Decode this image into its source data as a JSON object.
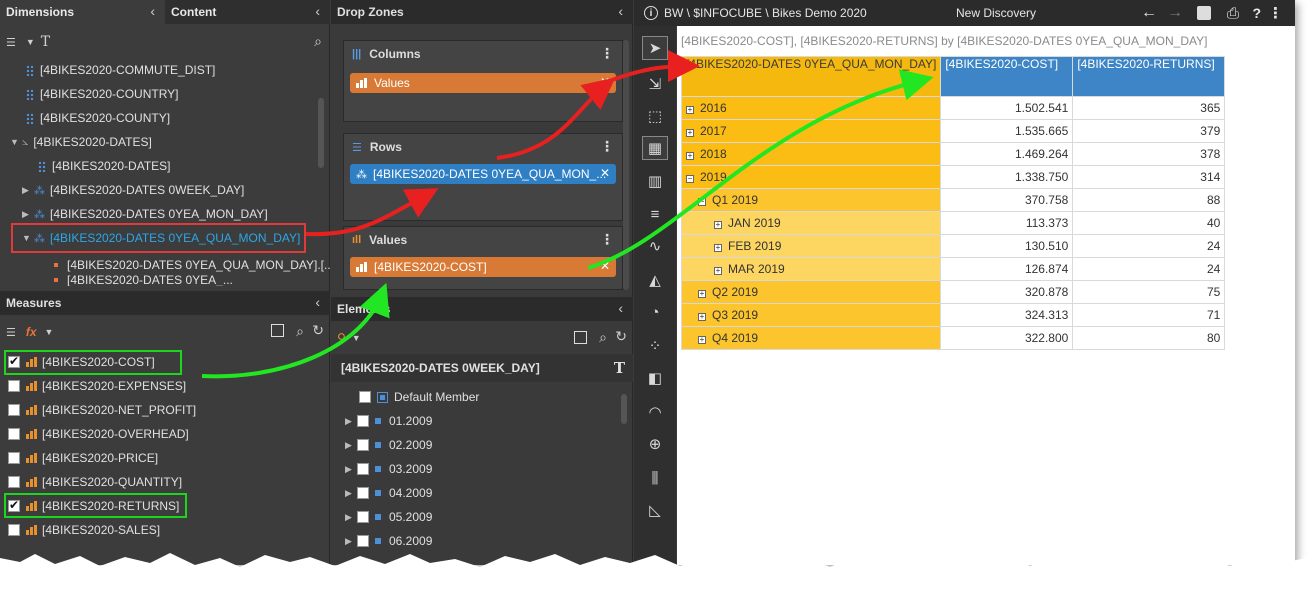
{
  "dimensions_panel": {
    "tab_dimensions": "Dimensions",
    "tab_content": "Content",
    "items": [
      {
        "label": "[4BIKES2020-COMMUTE_DIST]"
      },
      {
        "label": "[4BIKES2020-COUNTRY]"
      },
      {
        "label": "[4BIKES2020-COUNTY]"
      },
      {
        "label": "[4BIKES2020-DATES]"
      },
      {
        "label": "[4BIKES2020-DATES]"
      },
      {
        "label": "[4BIKES2020-DATES 0WEEK_DAY]"
      },
      {
        "label": "[4BIKES2020-DATES 0YEA_MON_DAY]"
      },
      {
        "label": "[4BIKES2020-DATES 0YEA_QUA_MON_DAY]"
      },
      {
        "label": "[4BIKES2020-DATES 0YEA_QUA_MON_DAY].[..."
      },
      {
        "label": "[4BIKES2020-DATES 0YEA_..."
      }
    ]
  },
  "measures_panel": {
    "title": "Measures",
    "items": [
      {
        "label": "[4BIKES2020-COST]",
        "checked": true
      },
      {
        "label": "[4BIKES2020-EXPENSES]",
        "checked": false
      },
      {
        "label": "[4BIKES2020-NET_PROFIT]",
        "checked": false
      },
      {
        "label": "[4BIKES2020-OVERHEAD]",
        "checked": false
      },
      {
        "label": "[4BIKES2020-PRICE]",
        "checked": false
      },
      {
        "label": "[4BIKES2020-QUANTITY]",
        "checked": false
      },
      {
        "label": "[4BIKES2020-RETURNS]",
        "checked": true
      },
      {
        "label": "[4BIKES2020-SALES]",
        "checked": false
      }
    ]
  },
  "drop_zones": {
    "title": "Drop Zones",
    "columns": {
      "label": "Columns",
      "pill": "Values"
    },
    "rows": {
      "label": "Rows",
      "pill": "[4BIKES2020-DATES 0YEA_QUA_MON_..."
    },
    "values": {
      "label": "Values",
      "pill": "[4BIKES2020-COST]"
    }
  },
  "elements_panel": {
    "title": "Elements",
    "hierarchy": "[4BIKES2020-DATES 0WEEK_DAY]",
    "items": [
      {
        "label": "Default Member"
      },
      {
        "label": "01.2009"
      },
      {
        "label": "02.2009"
      },
      {
        "label": "03.2009"
      },
      {
        "label": "04.2009"
      },
      {
        "label": "05.2009"
      },
      {
        "label": "06.2009"
      }
    ]
  },
  "topbar": {
    "path": "BW \\ $INFOCUBE \\ Bikes Demo 2020",
    "title": "New Discovery"
  },
  "report": {
    "title": "[4BIKES2020-COST], [4BIKES2020-RETURNS] by [4BIKES2020-DATES 0YEA_QUA_MON_DAY]",
    "row_header": "[4BIKES2020-DATES 0YEA_QUA_MON_DAY]",
    "col_headers": [
      "[4BIKES2020-COST]",
      "[4BIKES2020-RETURNS]"
    ],
    "rows": [
      {
        "label": "2016",
        "level": 0,
        "expander": "+",
        "cost": "1.502.541",
        "returns": "365"
      },
      {
        "label": "2017",
        "level": 0,
        "expander": "+",
        "cost": "1.535.665",
        "returns": "379"
      },
      {
        "label": "2018",
        "level": 0,
        "expander": "+",
        "cost": "1.469.264",
        "returns": "378"
      },
      {
        "label": "2019",
        "level": 0,
        "expander": "−",
        "cost": "1.338.750",
        "returns": "314"
      },
      {
        "label": "Q1 2019",
        "level": 1,
        "expander": "−",
        "cost": "370.758",
        "returns": "88"
      },
      {
        "label": "JAN 2019",
        "level": 2,
        "expander": "+",
        "cost": "113.373",
        "returns": "40"
      },
      {
        "label": "FEB 2019",
        "level": 2,
        "expander": "+",
        "cost": "130.510",
        "returns": "24"
      },
      {
        "label": "MAR 2019",
        "level": 2,
        "expander": "+",
        "cost": "126.874",
        "returns": "24"
      },
      {
        "label": "Q2 2019",
        "level": 1,
        "expander": "+",
        "cost": "320.878",
        "returns": "75"
      },
      {
        "label": "Q3 2019",
        "level": 1,
        "expander": "+",
        "cost": "324.313",
        "returns": "71"
      },
      {
        "label": "Q4 2019",
        "level": 1,
        "expander": "+",
        "cost": "322.800",
        "returns": "80"
      }
    ]
  },
  "colors": {
    "accent_blue": "#2ea6e8",
    "pill_orange": "#d87a36",
    "pill_blue": "#2f7fc4",
    "header_blue": "#3d85c6",
    "gold": "#f5b80f",
    "arrow_red": "#e82020",
    "arrow_green": "#22e622"
  }
}
